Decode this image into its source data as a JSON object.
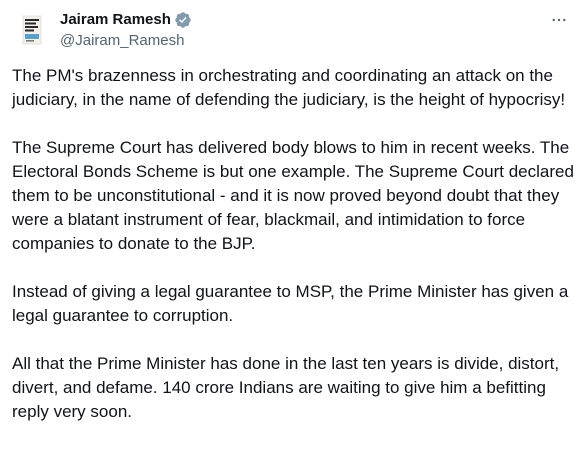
{
  "tweet": {
    "author": {
      "display_name": "Jairam Ramesh",
      "handle": "@Jairam_Ramesh",
      "verified": true,
      "verified_color": "#829aab",
      "avatar_icon": "book-cover-avatar"
    },
    "more_icon": "more-horizontal-icon",
    "paragraphs": [
      "The PM's brazenness in orchestrating and coordinating an attack on the judiciary, in the name of defending the judiciary, is the height of hypocrisy!",
      "The Supreme Court has delivered body blows to him in recent weeks. The Electoral Bonds Scheme is but one example. The Supreme Court declared them to be unconstitutional - and it is now proved beyond doubt that they were a blatant instrument of fear, blackmail, and intimidation to force companies to donate to the BJP.",
      "Instead of giving a legal guarantee to MSP, the Prime Minister has given a legal guarantee to corruption.",
      "All that the Prime Minister has done in the last ten years is divide, distort, divert, and defame. 140 crore Indians are waiting to give him a befitting reply very soon."
    ]
  }
}
